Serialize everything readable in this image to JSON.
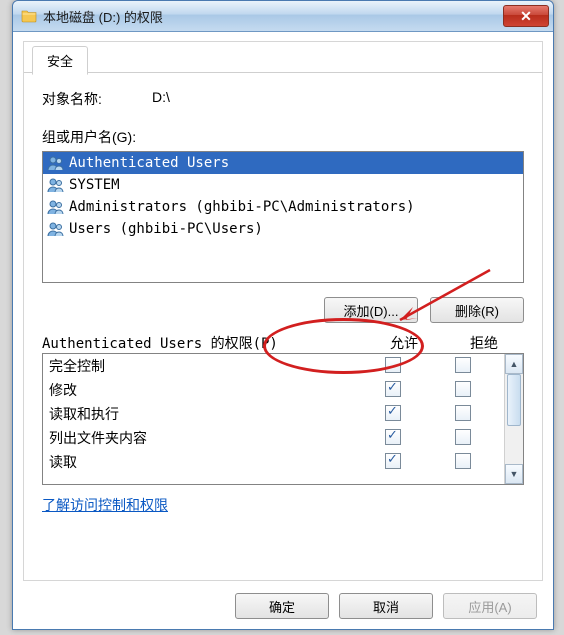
{
  "window": {
    "title": "本地磁盘 (D:) 的权限",
    "close_glyph": "✕"
  },
  "tabs": {
    "security": "安全"
  },
  "object": {
    "label": "对象名称:",
    "value": "D:\\"
  },
  "groups": {
    "label": "组或用户名(G):",
    "items": [
      {
        "name": "Authenticated Users",
        "selected": true
      },
      {
        "name": "SYSTEM",
        "selected": false
      },
      {
        "name": "Administrators (ghbibi-PC\\Administrators)",
        "selected": false
      },
      {
        "name": "Users (ghbibi-PC\\Users)",
        "selected": false
      }
    ]
  },
  "buttons": {
    "add": "添加(D)...",
    "remove": "删除(R)",
    "ok": "确定",
    "cancel": "取消",
    "apply": "应用(A)"
  },
  "perms": {
    "header_label": "Authenticated Users 的权限(P)",
    "allow": "允许",
    "deny": "拒绝",
    "rows": [
      {
        "name": "完全控制",
        "allow": false,
        "deny": false
      },
      {
        "name": "修改",
        "allow": true,
        "deny": false
      },
      {
        "name": "读取和执行",
        "allow": true,
        "deny": false
      },
      {
        "name": "列出文件夹内容",
        "allow": true,
        "deny": false
      },
      {
        "name": "读取",
        "allow": true,
        "deny": false
      }
    ]
  },
  "link": {
    "learn": "了解访问控制和权限"
  }
}
